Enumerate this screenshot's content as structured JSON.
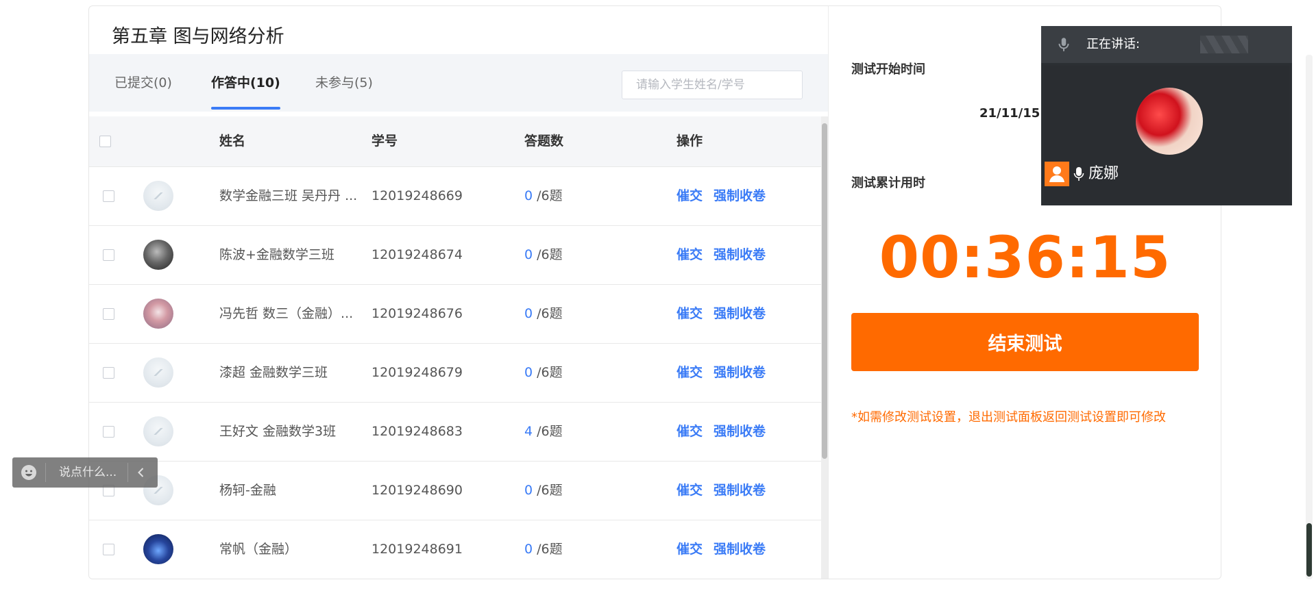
{
  "header": {
    "chapter_title": "第五章 图与网络分析"
  },
  "tabs": [
    {
      "label": "已提交(0)"
    },
    {
      "label": "作答中(10)"
    },
    {
      "label": "未参与(5)"
    }
  ],
  "search": {
    "placeholder": "请输入学生姓名/学号"
  },
  "table": {
    "headers": {
      "name": "姓名",
      "id": "学号",
      "count": "答题数",
      "ops": "操作"
    },
    "rows": [
      {
        "name": "数学金融三班 吴丹丹 ...",
        "student_id": "12019248669",
        "answered": "0",
        "total": "/6题",
        "urge": "催交",
        "force": "强制收卷"
      },
      {
        "name": "陈波+金融数学三班",
        "student_id": "12019248674",
        "answered": "0",
        "total": "/6题",
        "urge": "催交",
        "force": "强制收卷"
      },
      {
        "name": "冯先哲 数三（金融）...",
        "student_id": "12019248676",
        "answered": "0",
        "total": "/6题",
        "urge": "催交",
        "force": "强制收卷"
      },
      {
        "name": "漆超 金融数学三班",
        "student_id": "12019248679",
        "answered": "0",
        "total": "/6题",
        "urge": "催交",
        "force": "强制收卷"
      },
      {
        "name": "王好文 金融数学3班",
        "student_id": "12019248683",
        "answered": "4",
        "total": "/6题",
        "urge": "催交",
        "force": "强制收卷"
      },
      {
        "name": "杨轲-金融",
        "student_id": "12019248690",
        "answered": "0",
        "total": "/6题",
        "urge": "催交",
        "force": "强制收卷"
      },
      {
        "name": "常帆（金融）",
        "student_id": "12019248691",
        "answered": "0",
        "total": "/6题",
        "urge": "催交",
        "force": "强制收卷"
      }
    ]
  },
  "test_panel": {
    "start_label": "测试开始时间",
    "start_time": "21/11/15 1",
    "elapsed_label": "测试累计用时",
    "elapsed": "00:36:15",
    "end_button": "结束测试",
    "notice": "*如需修改测试设置，退出测试面板返回测试设置即可修改"
  },
  "video": {
    "speaking_label": "正在讲话:",
    "user_name": "庞娜"
  },
  "chat": {
    "placeholder": "说点什么..."
  },
  "colors": {
    "accent": "#3a7bf6",
    "warning": "#ff6a00"
  }
}
